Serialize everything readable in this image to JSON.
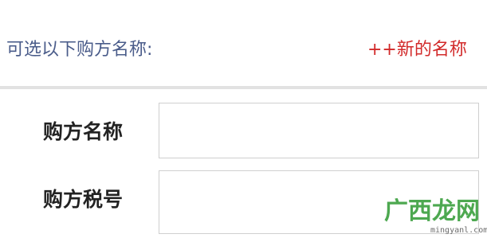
{
  "buyer_section": {
    "hint_label": "可选以下购方名称:",
    "new_name_link": "++新的名称"
  },
  "form": {
    "buyer_name": {
      "label": "购方名称",
      "value": "",
      "placeholder": ""
    },
    "buyer_tax_id": {
      "label": "购方税号",
      "value": "",
      "placeholder": ""
    }
  },
  "watermark": {
    "brand": "广西龙网",
    "url": "mingyanl.com"
  },
  "colors": {
    "hint_text": "#4a5c8a",
    "link_red": "#d22a2a",
    "watermark_green": "#2e9a32"
  }
}
